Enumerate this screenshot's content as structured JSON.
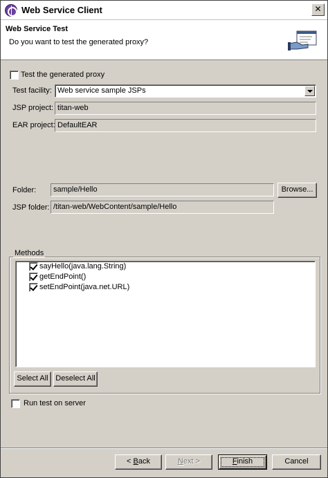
{
  "window": {
    "title": "Web Service Client"
  },
  "banner": {
    "title": "Web Service Test",
    "description": "Do you want to test the generated proxy?"
  },
  "form": {
    "test_proxy_label": "Test the generated proxy",
    "test_proxy_checked": false,
    "test_facility_label": "Test facility:",
    "test_facility_value": "Web service sample JSPs",
    "jsp_project_label": "JSP project:",
    "jsp_project_value": "titan-web",
    "ear_project_label": "EAR project:",
    "ear_project_value": "DefaultEAR",
    "folder_label": "Folder:",
    "folder_value": "sample/Hello",
    "browse_label": "Browse...",
    "jsp_folder_label": "JSP folder:",
    "jsp_folder_value": "/titan-web/WebContent/sample/Hello"
  },
  "methods": {
    "group_label": "Methods",
    "items": [
      {
        "label": "sayHello(java.lang.String)",
        "checked": true
      },
      {
        "label": "getEndPoint()",
        "checked": true
      },
      {
        "label": "setEndPoint(java.net.URL)",
        "checked": true
      }
    ],
    "select_all_label": "Select All",
    "deselect_all_label": "Deselect All"
  },
  "run_test": {
    "label": "Run test on server",
    "checked": false
  },
  "footer": {
    "back_prefix": "< ",
    "back_mnemonic": "B",
    "back_rest": "ack",
    "next_mnemonic": "N",
    "next_rest": "ext >",
    "finish_mnemonic": "F",
    "finish_rest": "inish",
    "cancel_label": "Cancel"
  },
  "icons": {
    "app": "eclipse-app-icon",
    "banner": "web-service-test-icon",
    "close": "close-icon",
    "dropdown": "chevron-down-icon"
  }
}
